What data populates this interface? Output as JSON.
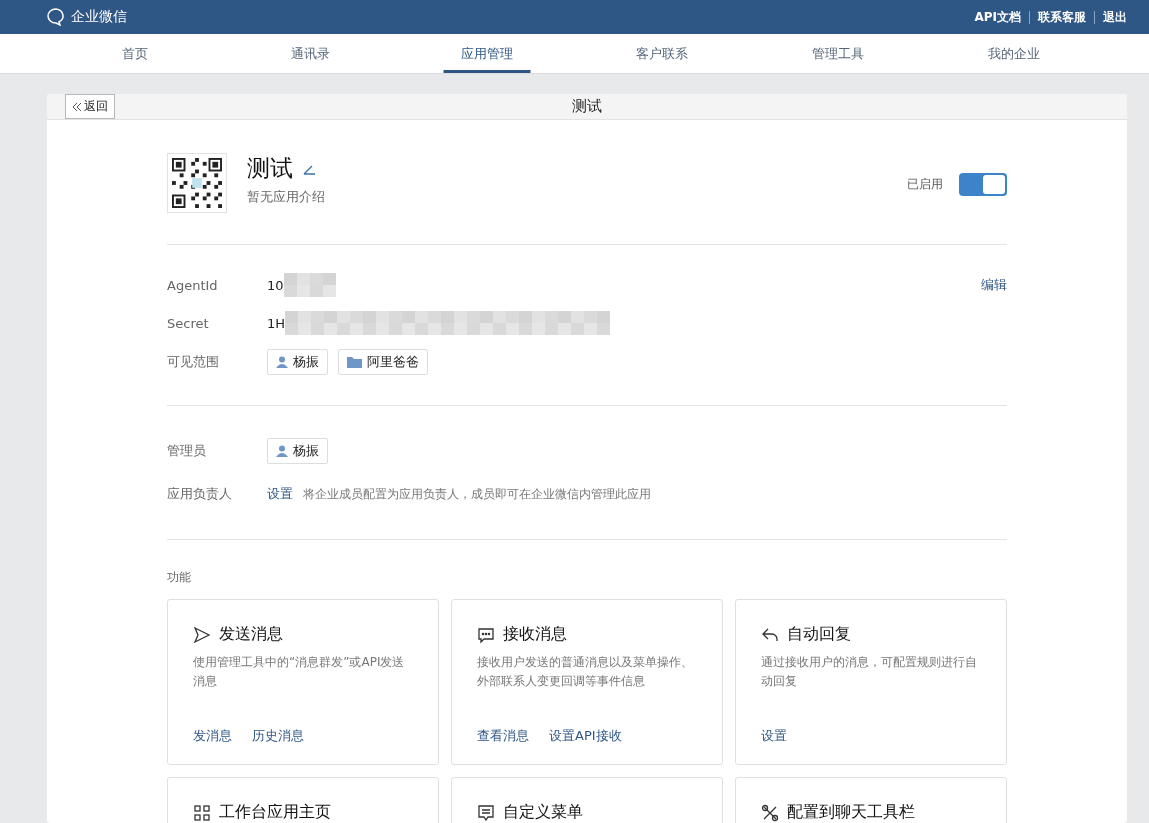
{
  "topbar": {
    "logo": "企业微信",
    "links": [
      "API文档",
      "联系客服",
      "退出"
    ]
  },
  "nav": [
    {
      "label": "首页",
      "selected": false
    },
    {
      "label": "通讯录",
      "selected": false
    },
    {
      "label": "应用管理",
      "selected": true
    },
    {
      "label": "客户联系",
      "selected": false
    },
    {
      "label": "管理工具",
      "selected": false
    },
    {
      "label": "我的企业",
      "selected": false
    }
  ],
  "page": {
    "back": "返回",
    "title": "测试"
  },
  "app": {
    "name": "测试",
    "intro": "暂无应用介绍",
    "status": "已启用",
    "enabled": true
  },
  "info": [
    {
      "label": "AgentId",
      "value": "10",
      "action": "编辑"
    },
    {
      "label": "Secret",
      "value": "1H"
    },
    {
      "label": "可见范围",
      "tags": [
        {
          "kind": "person",
          "text": "杨振"
        },
        {
          "kind": "department",
          "text": "阿里爸爸"
        }
      ]
    }
  ],
  "admins": {
    "label": "管理员",
    "tags": [
      {
        "kind": "person",
        "text": "杨振"
      }
    ]
  },
  "owner": {
    "label": "应用负责人",
    "link": "设置",
    "hint": "将企业成员配置为应用负责人，成员即可在企业微信内管理此应用"
  },
  "features": {
    "heading": "功能",
    "cards": [
      {
        "title": "发送消息",
        "desc": "使用管理工具中的“消息群发”或API发送消息",
        "links": [
          "发消息",
          "历史消息"
        ]
      },
      {
        "title": "接收消息",
        "desc": "接收用户发送的普通消息以及菜单操作、外部联系人变更回调等事件信息",
        "links": [
          "查看消息",
          "设置API接收"
        ]
      },
      {
        "title": "自动回复",
        "desc": "通过接收用户的消息，可配置规则进行自动回复",
        "links": [
          "设置"
        ]
      },
      {
        "title": "工作台应用主页"
      },
      {
        "title": "自定义菜单"
      },
      {
        "title": "配置到聊天工具栏"
      }
    ]
  }
}
